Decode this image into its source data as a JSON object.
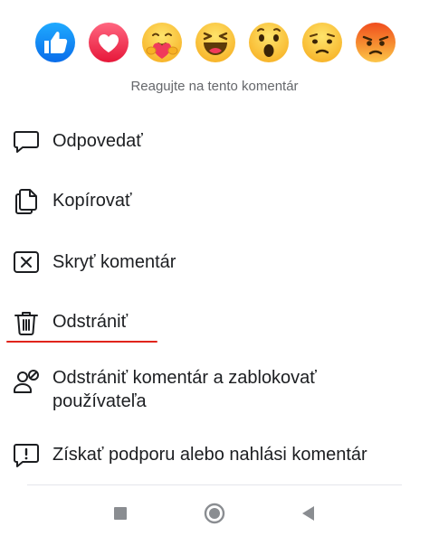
{
  "reactions": [
    {
      "name": "like",
      "icon": "like-reaction-icon"
    },
    {
      "name": "love",
      "icon": "love-reaction-icon"
    },
    {
      "name": "care",
      "icon": "care-reaction-icon"
    },
    {
      "name": "haha",
      "icon": "haha-reaction-icon"
    },
    {
      "name": "wow",
      "icon": "wow-reaction-icon"
    },
    {
      "name": "sad",
      "icon": "sad-reaction-icon"
    },
    {
      "name": "angry",
      "icon": "angry-reaction-icon"
    }
  ],
  "hint": "Reagujte na tento komentár",
  "menu": {
    "reply": {
      "label": "Odpovedať",
      "icon": "comment-bubble-icon"
    },
    "copy": {
      "label": "Kopírovať",
      "icon": "copy-icon"
    },
    "hide": {
      "label": "Skryť komentár",
      "icon": "hide-x-box-icon"
    },
    "delete": {
      "label": "Odstrániť",
      "icon": "trash-icon"
    },
    "delete_block": {
      "label_line1": "Odstrániť komentár a zablokovať",
      "label_line2": "používateľa",
      "icon": "user-block-icon"
    },
    "report": {
      "label": "Získať podporu alebo nahlási komentár",
      "icon": "report-exclamation-icon"
    }
  },
  "highlight_color": "#e0241b",
  "navbar": {
    "recents": "square-icon",
    "home": "circle-icon",
    "back": "triangle-back-icon"
  }
}
